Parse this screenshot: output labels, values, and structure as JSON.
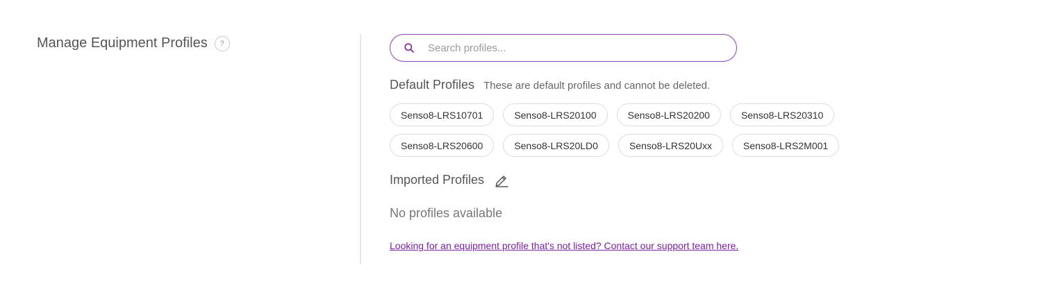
{
  "manage_section": {
    "title": "Manage Equipment Profiles",
    "help_icon": "?"
  },
  "search": {
    "placeholder": "Search profiles...",
    "value": "",
    "icon": "search-icon"
  },
  "default_profiles": {
    "title": "Default Profiles",
    "note": "These are default profiles and cannot be deleted.",
    "items": [
      "Senso8-LRS10701",
      "Senso8-LRS20100",
      "Senso8-LRS20200",
      "Senso8-LRS20310",
      "Senso8-LRS20600",
      "Senso8-LRS20LD0",
      "Senso8-LRS20Uxx",
      "Senso8-LRS2M001"
    ]
  },
  "imported_profiles": {
    "title": "Imported Profiles",
    "edit_icon": "pencil-icon",
    "empty_text": "No profiles available"
  },
  "support": {
    "link_text": "Looking for an equipment profile that's not listed? Contact our support team here."
  },
  "colors": {
    "accent": "#8a3fb8",
    "link": "#7b1fa2"
  }
}
